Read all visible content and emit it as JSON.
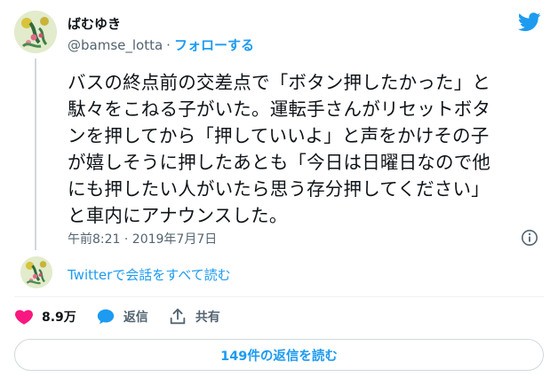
{
  "author": {
    "name": "ばむゆき",
    "handle": "@bamse_lotta",
    "separator": "·",
    "follow_label": "フォローする"
  },
  "tweet": {
    "text": "バスの終点前の交差点で「ボタン押したかった」と\n駄々をこねる子がいた。運転手さんがリセットボタ\nンを押してから「押していいよ」と声をかけその子\nが嬉しそうに押したあとも「今日は日曜日なので他\nにも押したい人がいたら思う存分押してください」\nと車内にアナウンスした。",
    "timestamp": "午前8:21 · 2019年7月7日"
  },
  "read_conversation_label": "Twitterで会話をすべて読む",
  "actions": {
    "like_count": "8.9万",
    "reply_label": "返信",
    "share_label": "共有"
  },
  "replies_button_label": "149件の返信を読む",
  "colors": {
    "accent": "#1d9bf0",
    "like": "#f91880",
    "text": "#0f1419",
    "secondary": "#536471"
  },
  "icons": {
    "brand": "twitter-bird-icon",
    "info": "info-icon",
    "like": "heart-icon",
    "reply": "speech-bubble-icon",
    "share": "share-upload-icon"
  }
}
